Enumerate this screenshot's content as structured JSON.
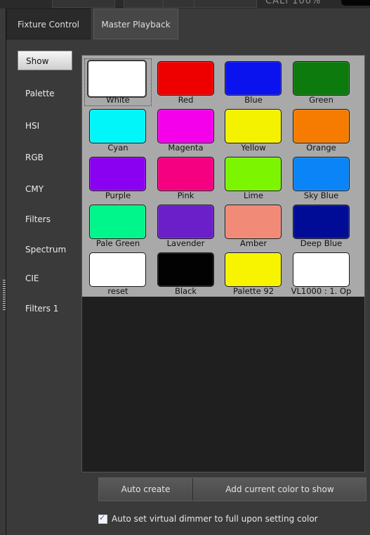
{
  "topbar": {
    "zoom_text": "CALI 100%"
  },
  "tabs": [
    {
      "label": "Fixture Control",
      "active": false
    },
    {
      "label": "Master Playback",
      "active": true
    }
  ],
  "sidebar": {
    "items": [
      {
        "label": "Show",
        "active": true
      },
      {
        "label": "Palette"
      },
      {
        "label": "HSI"
      },
      {
        "label": "RGB"
      },
      {
        "label": "CMY"
      },
      {
        "label": "Filters"
      },
      {
        "label": "Spectrum"
      },
      {
        "label": "CIE"
      },
      {
        "label": "Filters 1"
      }
    ]
  },
  "palette": {
    "items": [
      {
        "label": "White",
        "color": "#ffffff",
        "selected": true
      },
      {
        "label": "Red",
        "color": "#ef0000"
      },
      {
        "label": "Blue",
        "color": "#0a12ee"
      },
      {
        "label": "Green",
        "color": "#0c7a0c"
      },
      {
        "label": "Cyan",
        "color": "#00f6f8"
      },
      {
        "label": "Magenta",
        "color": "#f400ea"
      },
      {
        "label": "Yellow",
        "color": "#f5f200"
      },
      {
        "label": "Orange",
        "color": "#f57c00"
      },
      {
        "label": "Purple",
        "color": "#8a00f0"
      },
      {
        "label": "Pink",
        "color": "#f50080"
      },
      {
        "label": "Lime",
        "color": "#7cf500"
      },
      {
        "label": "Sky Blue",
        "color": "#0a84f6"
      },
      {
        "label": "Pale Green",
        "color": "#00f58a"
      },
      {
        "label": "Lavender",
        "color": "#6a1fc8"
      },
      {
        "label": "Amber",
        "color": "#f28a78"
      },
      {
        "label": "Deep Blue",
        "color": "#000c96"
      },
      {
        "label": "reset",
        "color": "#ffffff"
      },
      {
        "label": "Black",
        "color": "#020202"
      },
      {
        "label": "Palette 92",
        "color": "#f8f400"
      },
      {
        "label": "VL1000 : 1. Op",
        "color": "#ffffff"
      }
    ]
  },
  "buttons": {
    "auto_create": "Auto create",
    "add_color": "Add current color to show"
  },
  "options": {
    "auto_dimmer_label": "Auto set virtual dimmer to full upon setting color",
    "auto_dimmer_checked": true
  }
}
